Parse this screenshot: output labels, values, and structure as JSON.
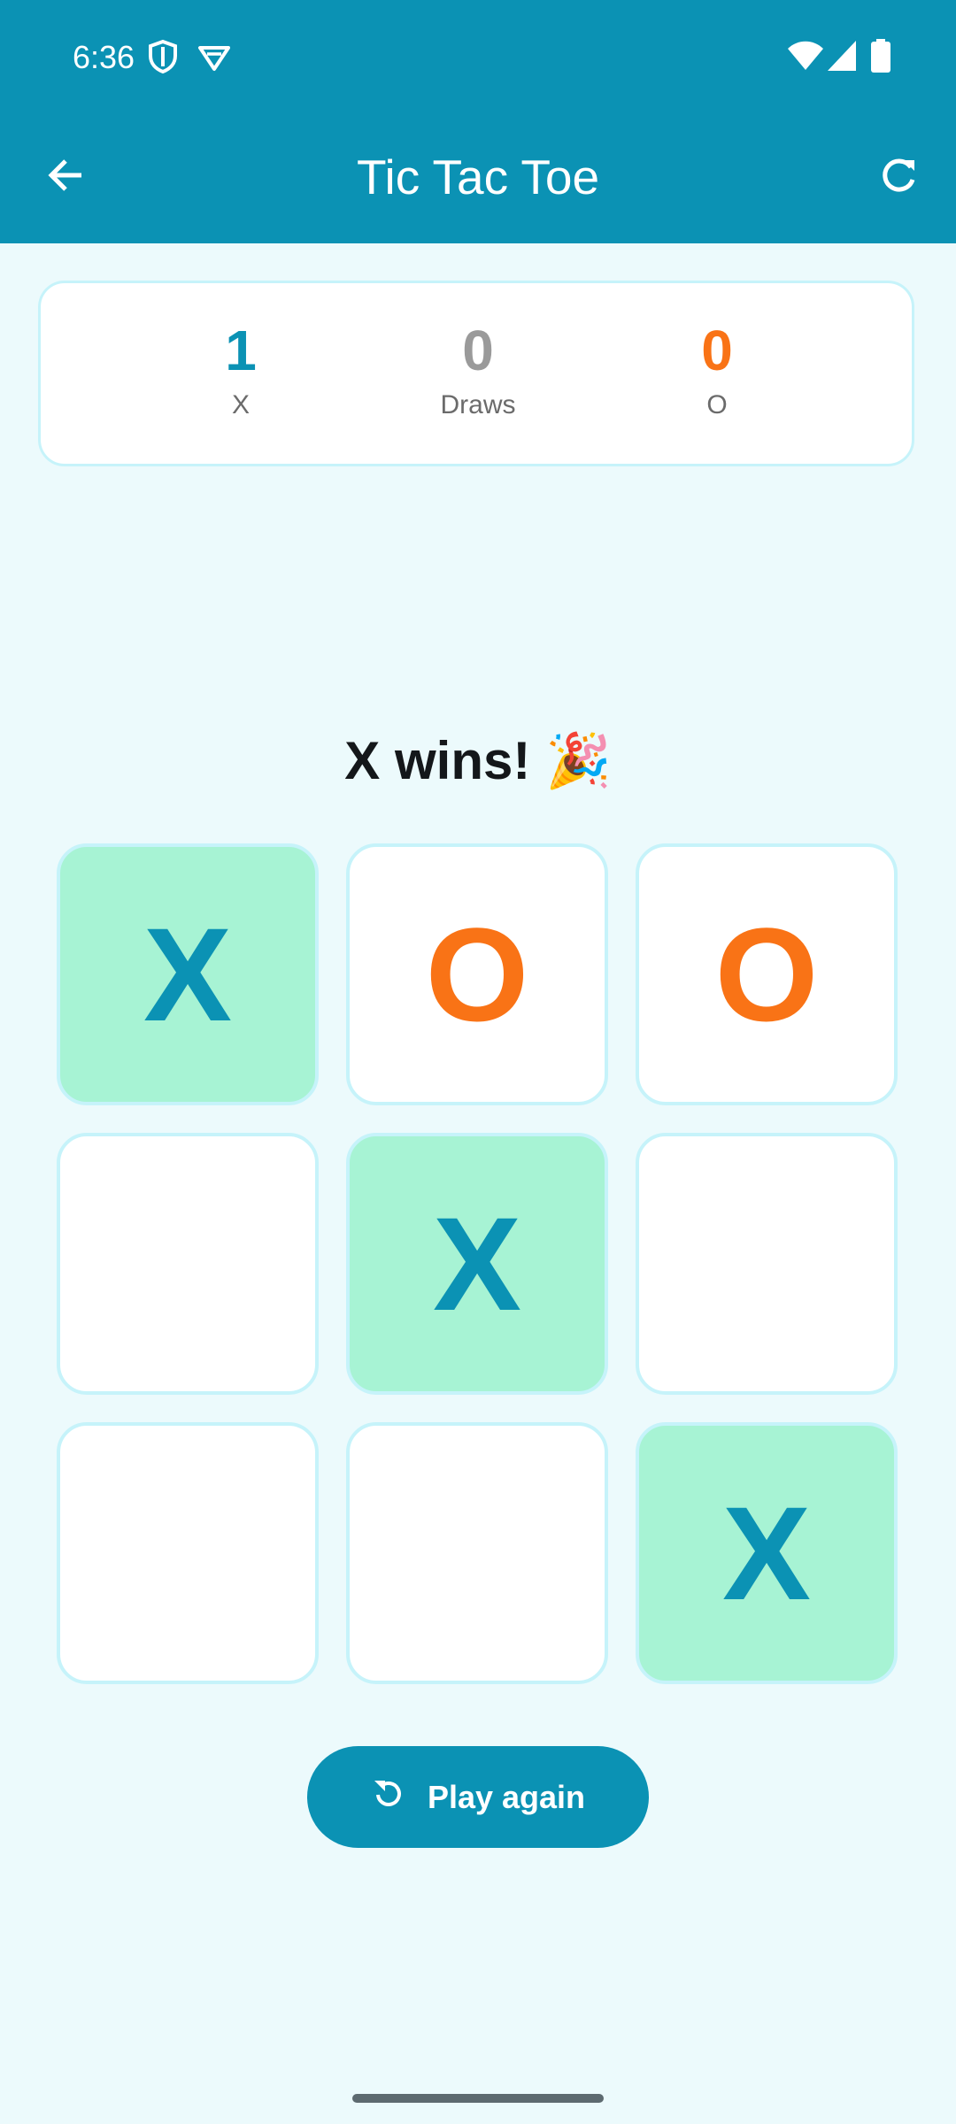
{
  "status_bar": {
    "time": "6:36",
    "icons": [
      "shield-icon",
      "vpn-icon",
      "wifi-icon",
      "signal-icon",
      "battery-icon"
    ]
  },
  "app_bar": {
    "title": "Tic Tac Toe",
    "back_icon": "arrow-left-icon",
    "refresh_icon": "refresh-icon"
  },
  "scores": {
    "x": {
      "value": "1",
      "label": "X",
      "color": "#0b92b4"
    },
    "draws": {
      "value": "0",
      "label": "Draws",
      "color": "#9a9a9a"
    },
    "o": {
      "value": "0",
      "label": "O",
      "color": "#f97316"
    }
  },
  "game": {
    "status": "X wins! 🎉",
    "board": [
      {
        "mark": "X",
        "win": true
      },
      {
        "mark": "O",
        "win": false
      },
      {
        "mark": "O",
        "win": false
      },
      {
        "mark": "",
        "win": false
      },
      {
        "mark": "X",
        "win": true
      },
      {
        "mark": "",
        "win": false
      },
      {
        "mark": "",
        "win": false
      },
      {
        "mark": "",
        "win": false
      },
      {
        "mark": "X",
        "win": true
      }
    ]
  },
  "actions": {
    "play_again_label": "Play again",
    "play_again_icon": "replay-icon"
  },
  "colors": {
    "primary": "#0b92b4",
    "accent_o": "#f97316",
    "win_cell": "#a7f3d4",
    "background": "#ecfafc"
  }
}
